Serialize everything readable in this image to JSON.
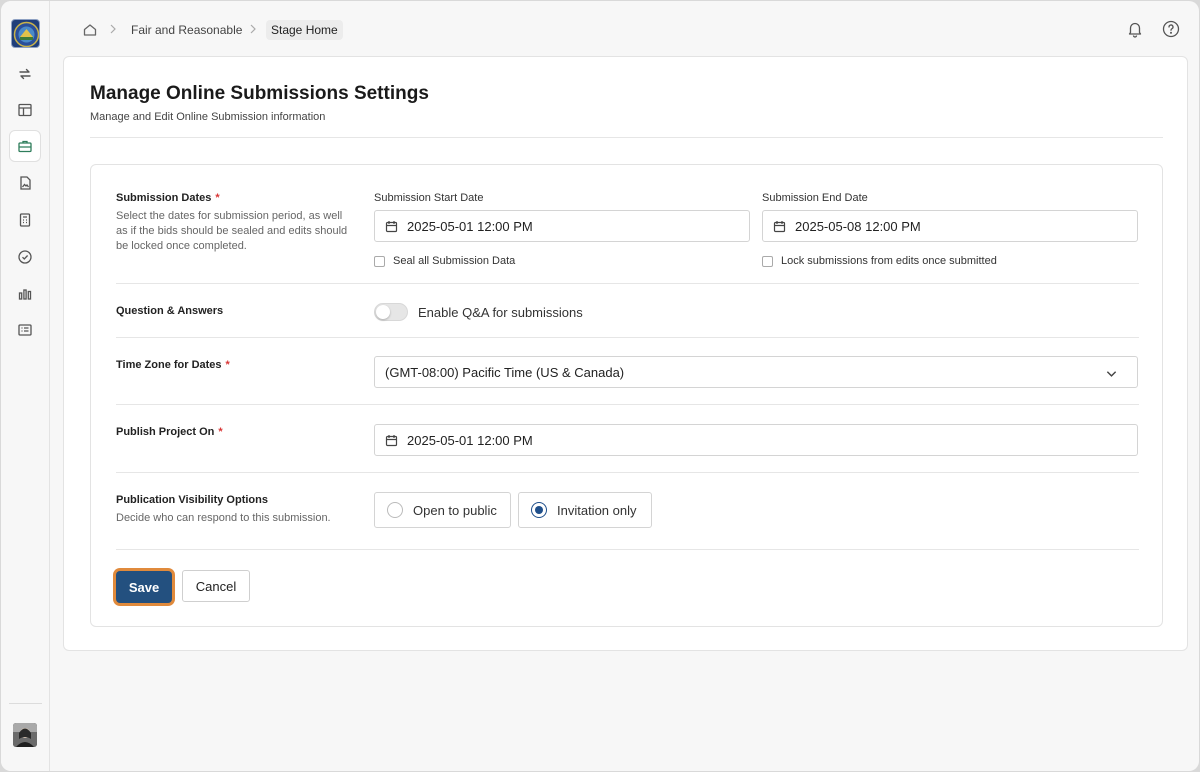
{
  "breadcrumb": {
    "items": [
      "Fair and Reasonable",
      "Stage Home"
    ]
  },
  "header": {
    "title": "Manage Online Submissions Settings",
    "subtitle": "Manage and Edit Online Submission information"
  },
  "submission_dates": {
    "label": "Submission Dates",
    "required_mark": "*",
    "help": "Select the dates for submission period, as well as if the bids should be sealed and edits should be locked once completed.",
    "start_label": "Submission Start Date",
    "start_value": "2025-05-01 12:00 PM",
    "end_label": "Submission End Date",
    "end_value": "2025-05-08 12:00 PM",
    "seal_label": "Seal all Submission Data",
    "lock_label": "Lock submissions from edits once submitted"
  },
  "qa": {
    "label": "Question & Answers",
    "toggle_label": "Enable Q&A for submissions"
  },
  "timezone": {
    "label": "Time Zone for Dates",
    "required_mark": "*",
    "value": "(GMT-08:00) Pacific Time (US & Canada)"
  },
  "publish": {
    "label": "Publish Project On",
    "required_mark": "*",
    "value": "2025-05-01 12:00 PM"
  },
  "visibility": {
    "label": "Publication Visibility Options",
    "help": "Decide who can respond to this submission.",
    "options": [
      "Open to public",
      "Invitation only"
    ],
    "selected": "Invitation only"
  },
  "actions": {
    "save_label": "Save",
    "cancel_label": "Cancel"
  },
  "colors": {
    "primary": "#23507f",
    "focus_ring": "#e08a3c",
    "required": "#d93636",
    "active_nav": "#2e7d5b"
  }
}
